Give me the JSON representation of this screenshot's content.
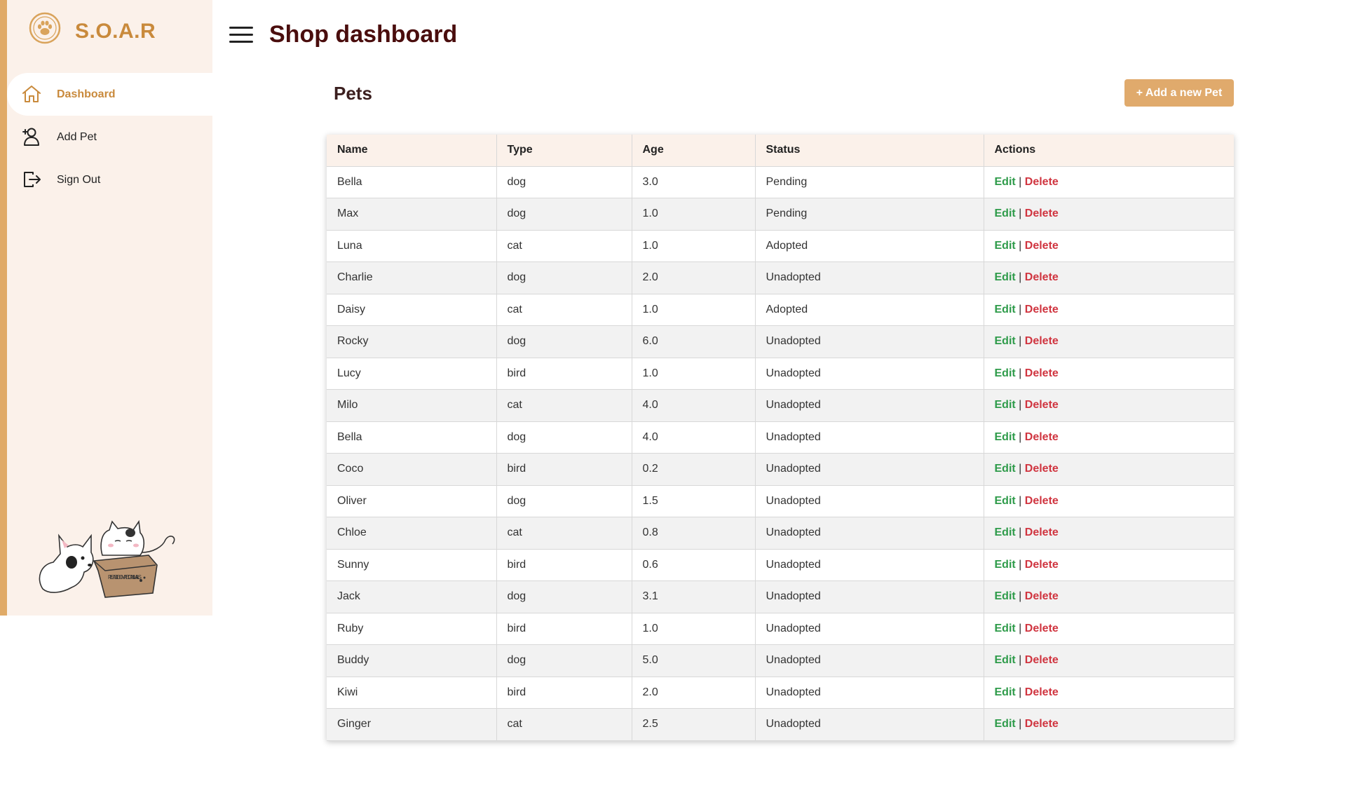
{
  "brand": {
    "name": "S.O.A.R"
  },
  "colors": {
    "accent": "#e0aa67",
    "brand": "#c98a3c",
    "edit": "#2e9b4a",
    "delete": "#d03540",
    "title": "#4a0d0d"
  },
  "sidebar": {
    "items": [
      {
        "label": "Dashboard",
        "icon": "home-icon",
        "active": true
      },
      {
        "label": "Add Pet",
        "icon": "add-user-icon",
        "active": false
      },
      {
        "label": "Sign Out",
        "icon": "sign-out-icon",
        "active": false
      }
    ],
    "illustration_text": "PLEASE DONATE TO ANIMALS"
  },
  "header": {
    "title": "Shop dashboard"
  },
  "main": {
    "section_title": "Pets",
    "add_button": "+ Add a new Pet",
    "table": {
      "columns": [
        "Name",
        "Type",
        "Age",
        "Status",
        "Actions"
      ],
      "edit_label": "Edit",
      "separator": "|",
      "delete_label": "Delete",
      "rows": [
        {
          "name": "Bella",
          "type": "dog",
          "age": "3.0",
          "status": "Pending"
        },
        {
          "name": "Max",
          "type": "dog",
          "age": "1.0",
          "status": "Pending"
        },
        {
          "name": "Luna",
          "type": "cat",
          "age": "1.0",
          "status": "Adopted"
        },
        {
          "name": "Charlie",
          "type": "dog",
          "age": "2.0",
          "status": "Unadopted"
        },
        {
          "name": "Daisy",
          "type": "cat",
          "age": "1.0",
          "status": "Adopted"
        },
        {
          "name": "Rocky",
          "type": "dog",
          "age": "6.0",
          "status": "Unadopted"
        },
        {
          "name": "Lucy",
          "type": "bird",
          "age": "1.0",
          "status": "Unadopted"
        },
        {
          "name": "Milo",
          "type": "cat",
          "age": "4.0",
          "status": "Unadopted"
        },
        {
          "name": "Bella",
          "type": "dog",
          "age": "4.0",
          "status": "Unadopted"
        },
        {
          "name": "Coco",
          "type": "bird",
          "age": "0.2",
          "status": "Unadopted"
        },
        {
          "name": "Oliver",
          "type": "dog",
          "age": "1.5",
          "status": "Unadopted"
        },
        {
          "name": "Chloe",
          "type": "cat",
          "age": "0.8",
          "status": "Unadopted"
        },
        {
          "name": "Sunny",
          "type": "bird",
          "age": "0.6",
          "status": "Unadopted"
        },
        {
          "name": "Jack",
          "type": "dog",
          "age": "3.1",
          "status": "Unadopted"
        },
        {
          "name": "Ruby",
          "type": "bird",
          "age": "1.0",
          "status": "Unadopted"
        },
        {
          "name": "Buddy",
          "type": "dog",
          "age": "5.0",
          "status": "Unadopted"
        },
        {
          "name": "Kiwi",
          "type": "bird",
          "age": "2.0",
          "status": "Unadopted"
        },
        {
          "name": "Ginger",
          "type": "cat",
          "age": "2.5",
          "status": "Unadopted"
        }
      ]
    }
  }
}
